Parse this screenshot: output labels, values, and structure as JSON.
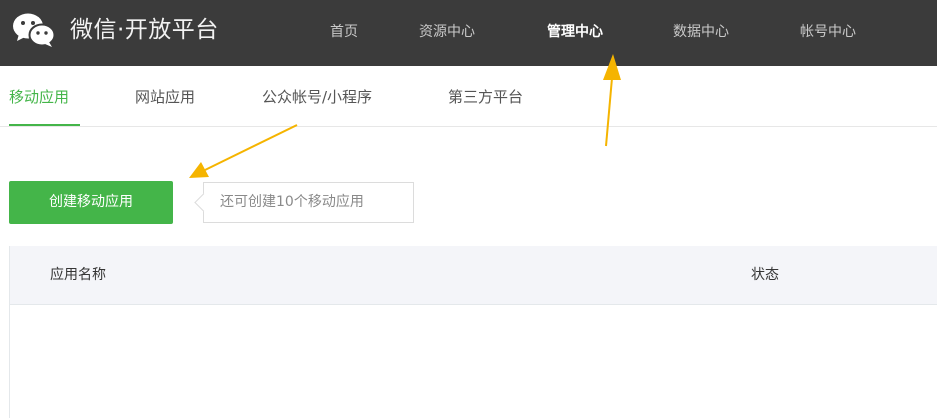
{
  "header": {
    "brand": "微信·开放平台",
    "nav": [
      {
        "label": "首页",
        "active": false
      },
      {
        "label": "资源中心",
        "active": false
      },
      {
        "label": "管理中心",
        "active": true
      },
      {
        "label": "数据中心",
        "active": false
      },
      {
        "label": "帐号中心",
        "active": false
      }
    ]
  },
  "subnav": {
    "tabs": [
      {
        "label": "移动应用",
        "active": true
      },
      {
        "label": "网站应用",
        "active": false
      },
      {
        "label": "公众帐号/小程序",
        "active": false
      },
      {
        "label": "第三方平台",
        "active": false
      }
    ]
  },
  "actions": {
    "create_label": "创建移动应用",
    "quota_tip": "还可创建10个移动应用"
  },
  "table": {
    "columns": [
      "应用名称",
      "状态"
    ],
    "rows": []
  },
  "icons": {
    "logo": "wechat-logo-icon",
    "annotation": "arrow-icon"
  },
  "colors": {
    "header_bg": "#3b3b3b",
    "accent_green": "#44b549",
    "annotation_arrow": "#f5b400"
  }
}
